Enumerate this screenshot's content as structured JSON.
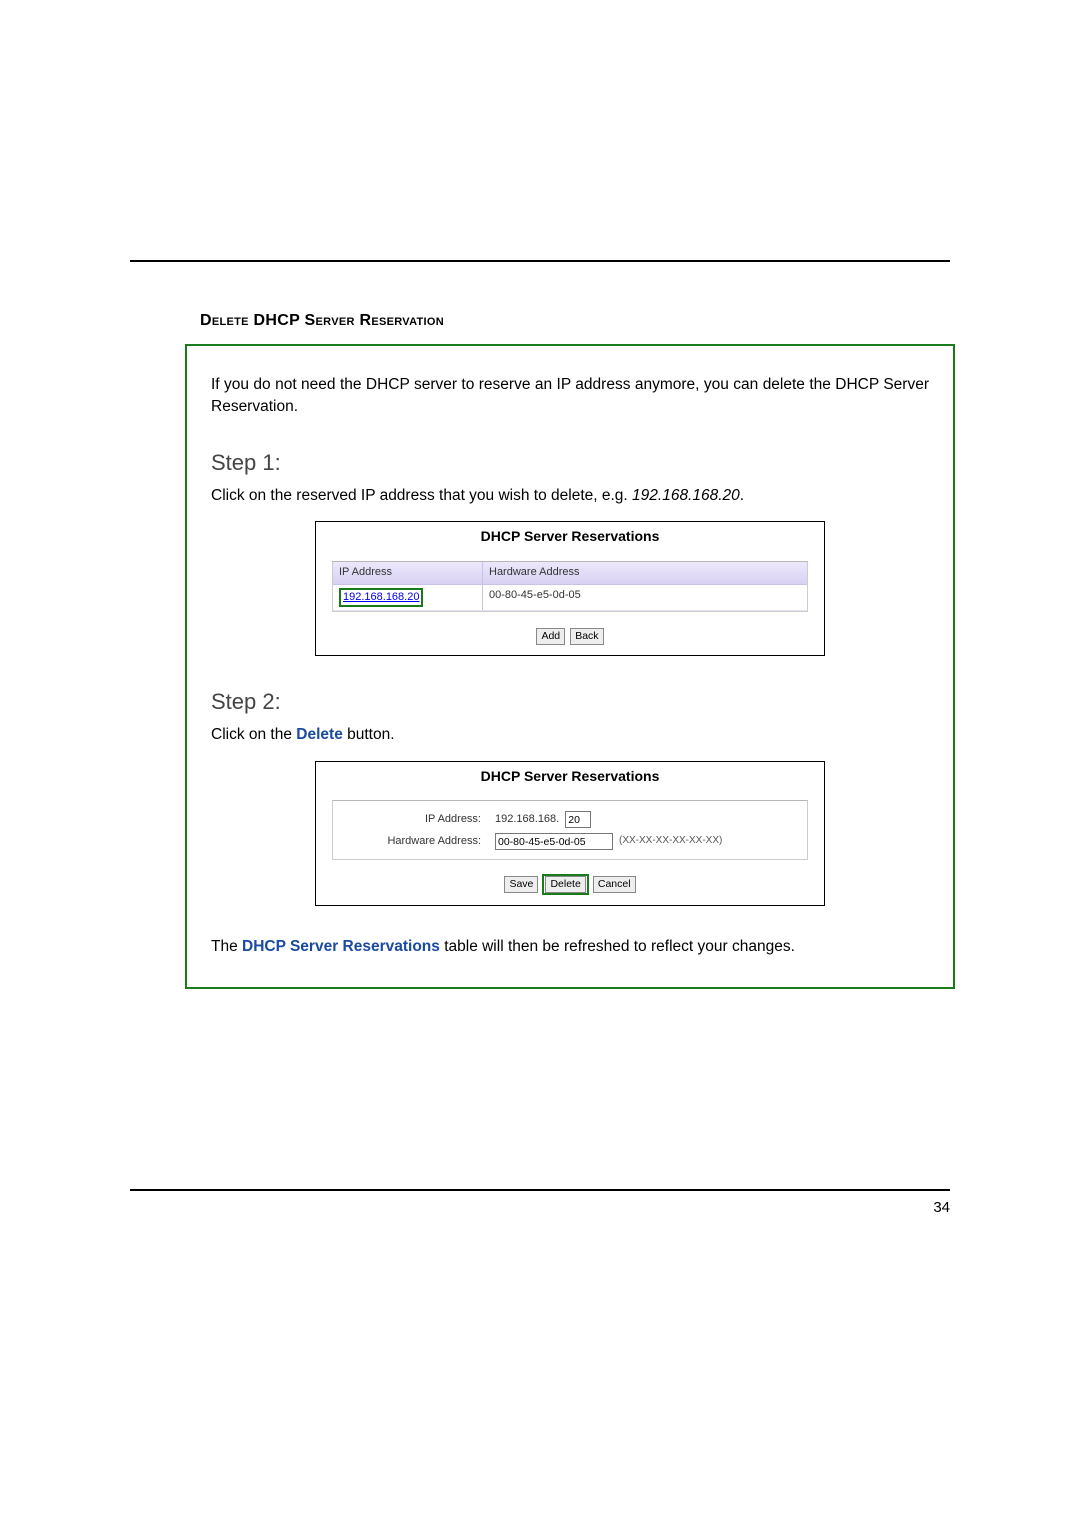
{
  "section_title": "Delete DHCP Server Reservation",
  "intro": "If you do not need the DHCP server to reserve an IP address anymore, you can delete the DHCP Server Reservation.",
  "step1": {
    "heading": "Step 1:",
    "body_prefix": "Click on the reserved IP address that you wish to delete, e.g. ",
    "body_example": "192.168.168.20",
    "body_suffix": "."
  },
  "panel1": {
    "title": "DHCP Server Reservations",
    "col_ip": "IP Address",
    "col_hw": "Hardware Address",
    "row_ip": "192.168.168.20",
    "row_hw": "00-80-45-e5-0d-05",
    "btn_add": "Add",
    "btn_back": "Back"
  },
  "step2": {
    "heading": "Step 2:",
    "body_prefix": "Click on the ",
    "body_bold": "Delete",
    "body_suffix": " button."
  },
  "panel2": {
    "title": "DHCP Server Reservations",
    "label_ip": "IP Address:",
    "value_ip_prefix": "192.168.168.",
    "value_ip_last": "20",
    "label_hw": "Hardware Address:",
    "value_hw": "00-80-45-e5-0d-05",
    "hint_hw": "(XX-XX-XX-XX-XX-XX)",
    "btn_save": "Save",
    "btn_delete": "Delete",
    "btn_cancel": "Cancel"
  },
  "conclusion_prefix": "The ",
  "conclusion_bold": "DHCP Server Reservations",
  "conclusion_suffix": " table will then be refreshed to reflect your changes.",
  "page_number": "34"
}
